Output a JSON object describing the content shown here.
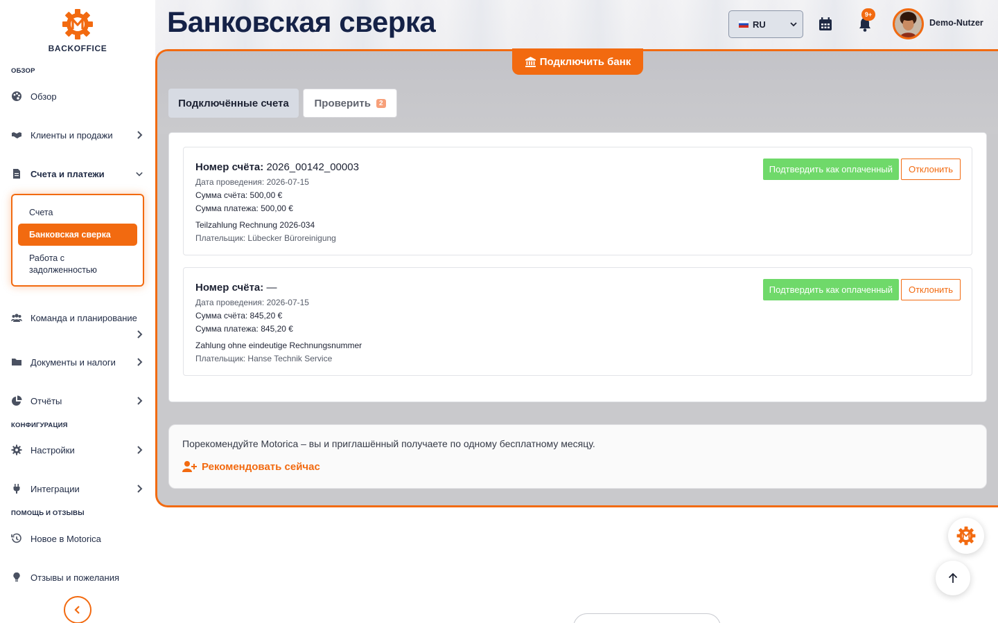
{
  "brand": {
    "name": "BACKOFFICE",
    "accent": "#f26a10",
    "navy": "#152247"
  },
  "header": {
    "title": "Банковская сверка",
    "language": "RU",
    "notifications_badge": "9+",
    "user_name": "Demo-Nutzer"
  },
  "sidebar": {
    "sections": {
      "overview": "ОБЗОР",
      "config": "КОНФИГУРАЦИЯ",
      "help": "ПОМОЩЬ И ОТЗЫВЫ"
    },
    "items": {
      "overview": "Обзор",
      "customers": "Клиенты и продажи",
      "invoices": "Счета и платежи",
      "team": "Команда и планирование",
      "documents": "Документы и налоги",
      "reports": "Отчёты",
      "settings": "Настройки",
      "integrations": "Интеграции",
      "news": "Новое в Motorica",
      "feedback": "Отзывы и пожелания"
    },
    "submenu": {
      "invoices": "Счета",
      "bank": "Банковская сверка",
      "debt": "Работа с задолженностью"
    }
  },
  "main": {
    "connect_bank": "Подключить банк",
    "tabs": [
      {
        "label": "Подключённые счета"
      },
      {
        "label": "Проверить",
        "count": "2"
      }
    ],
    "transactions": [
      {
        "number_label": "Номер счёта:",
        "number": "2026_00142_00003",
        "booking_date": "Дата проведения: 2026-07-15",
        "invoice_amount": "Сумма счёта: 500,00 €",
        "payment_amount": "Сумма платежа: 500,00 €",
        "purpose": "Teilzahlung Rechnung 2026-034",
        "payer": "Плательщик: Lübecker Büroreinigung",
        "confirm": "Подтвердить как оплаченный",
        "reject": "Отклонить"
      },
      {
        "number_label": "Номер счёта:",
        "number": "—",
        "booking_date": "Дата проведения: 2026-07-15",
        "invoice_amount": "Сумма счёта: 845,20 €",
        "payment_amount": "Сумма платежа: 845,20 €",
        "purpose": "Zahlung ohne eindeutige Rechnungsnummer",
        "payer": "Плательщик: Hanse Technik Service",
        "confirm": "Подтвердить как оплаченный",
        "reject": "Отклонить"
      }
    ],
    "referral": {
      "text": "Порекомендуйте Motorica – вы и приглашённый получаете по одному бесплатному месяцу.",
      "link": "Рекомендовать сейчас"
    }
  }
}
